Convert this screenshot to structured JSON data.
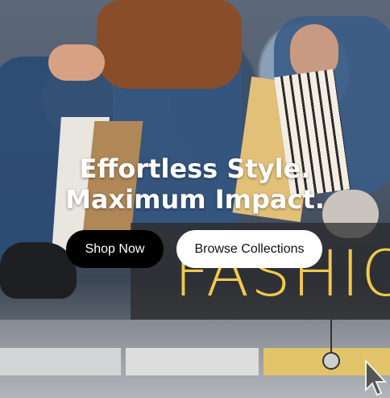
{
  "hero": {
    "headline_line1": "Effortless Style.",
    "headline_line2": "Maximum Impact.",
    "background_sign_text": "FASHIO"
  },
  "actions": {
    "primary_label": "Shop Now",
    "secondary_label": "Browse Collections"
  },
  "colors": {
    "accent_yellow": "#f2c94c",
    "primary_button_bg": "#000000",
    "secondary_button_bg": "#ffffff",
    "headline_text": "#ffffff"
  },
  "icons": {
    "cursor": "mouse-pointer-icon"
  }
}
